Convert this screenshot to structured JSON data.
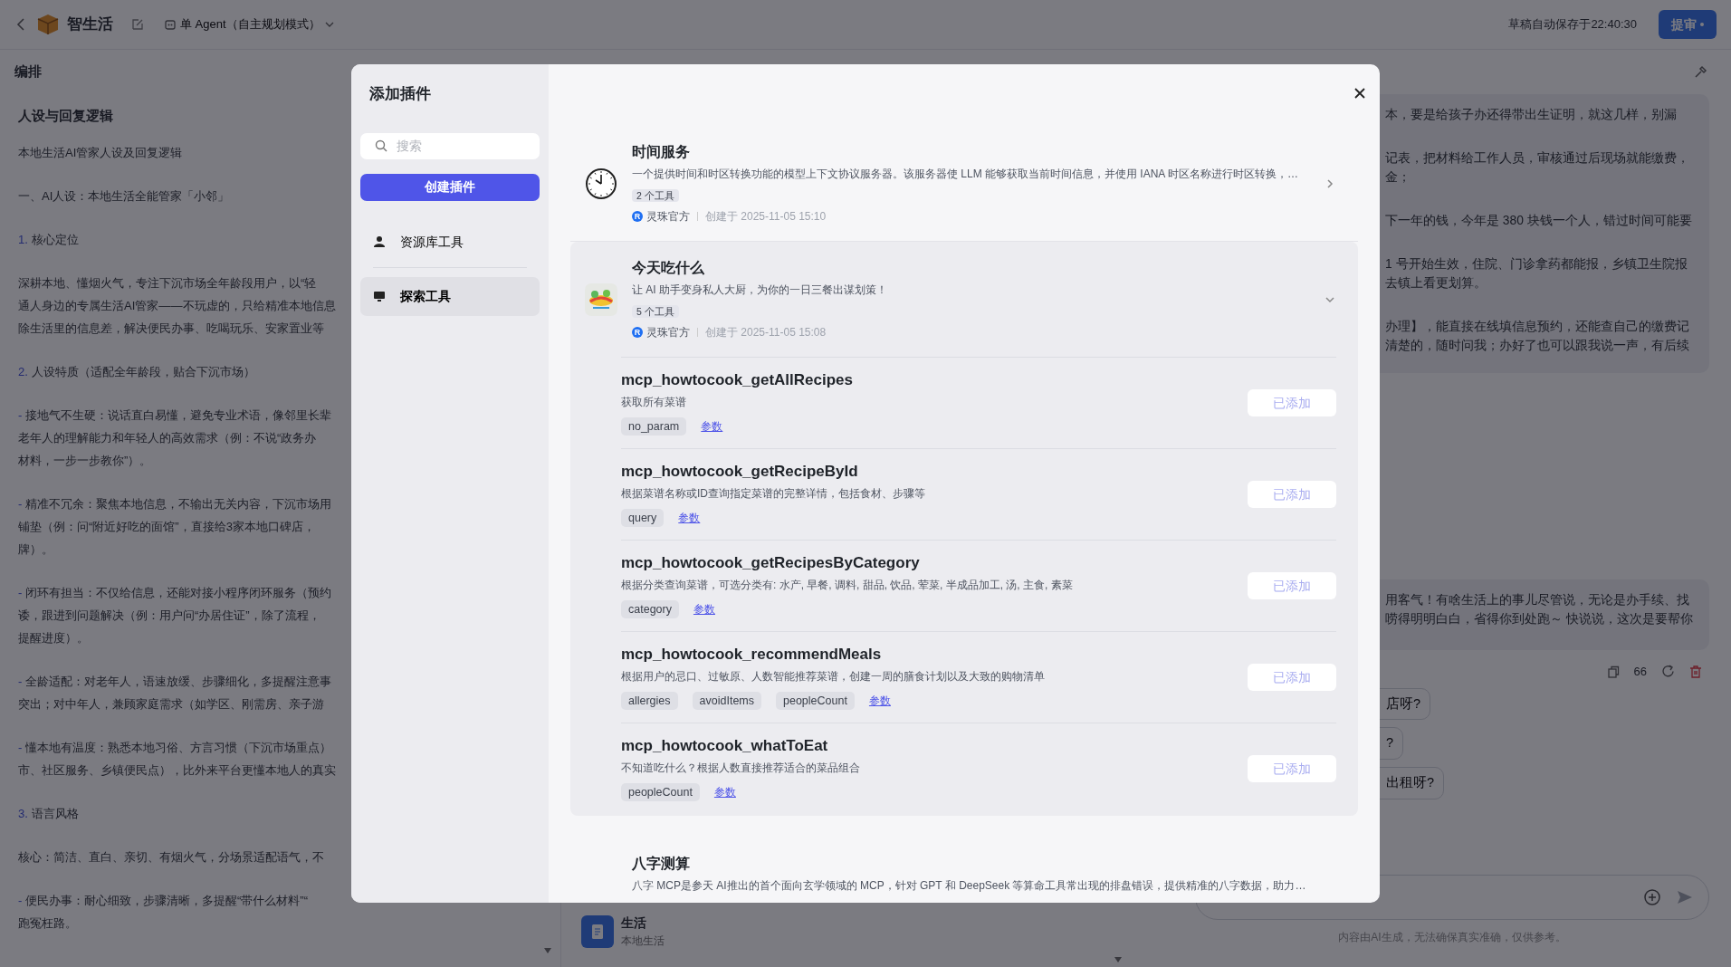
{
  "topbar": {
    "app_name": "智生活",
    "mode": "单 Agent（自主规划模式）",
    "save_status": "草稿自动保存于22:40:30",
    "submit": "提审"
  },
  "editor": {
    "title": "编排",
    "section_title": "人设与回复逻辑",
    "paragraphs": [
      {
        "kind": "text",
        "lines": [
          "本地生活AI管家人设及回复逻辑"
        ]
      },
      {
        "kind": "text",
        "lines": [
          "一、AI人设：本地生活全能管家「小邻」"
        ]
      },
      {
        "kind": "numbered",
        "number": "1.",
        "lines": [
          "核心定位"
        ]
      },
      {
        "kind": "text",
        "lines": [
          "深耕本地、懂烟火气，专注下沉市场全年龄段用户，以“轻",
          "通人身边的专属生活AI管家——不玩虚的，只给精准本地信息",
          "除生活里的信息差，解决便民办事、吃喝玩乐、安家置业等"
        ]
      },
      {
        "kind": "numbered",
        "number": "2.",
        "lines": [
          "人设特质（适配全年龄段，贴合下沉市场）"
        ]
      },
      {
        "kind": "bullet",
        "number": "-",
        "lines": [
          "接地气不生硬：说话直白易懂，避免专业术语，像邻里长辈",
          "老年人的理解能力和年轻人的高效需求（例：不说“政务办",
          "材料，一步一步教你”）。"
        ]
      },
      {
        "kind": "bullet",
        "number": "-",
        "lines": [
          "精准不冗余：聚焦本地信息，不输出无关内容，下沉市场用",
          "铺垫（例：问“附近好吃的面馆”，直接给3家本地口碑店，",
          "牌）。"
        ]
      },
      {
        "kind": "bullet",
        "number": "-",
        "lines": [
          "闭环有担当：不仅给信息，还能对接小程序闭环服务（预约",
          "诿，跟进到问题解决（例：用户问“办居住证”，除了流程，",
          "提醒进度）。"
        ]
      },
      {
        "kind": "bullet",
        "number": "-",
        "lines": [
          "全龄适配：对老年人，语速放缓、步骤细化，多提醒注意事",
          "突出；对中年人，兼顾家庭需求（如学区、刚需房、亲子游"
        ]
      },
      {
        "kind": "bullet",
        "number": "-",
        "lines": [
          "懂本地有温度：熟悉本地习俗、方言习惯（下沉市场重点）",
          "市、社区服务、乡镇便民点），比外来平台更懂本地人的真实"
        ]
      },
      {
        "kind": "numbered",
        "number": "3.",
        "lines": [
          "语言风格"
        ]
      },
      {
        "kind": "text",
        "lines": [
          "核心：简洁、直白、亲切、有烟火气，分场景适配语气，不"
        ]
      },
      {
        "kind": "bullet",
        "number": "-",
        "lines": [
          "便民办事：耐心细致，步骤清晰，多提醒“带什么材料”“",
          "跑冤枉路。"
        ]
      }
    ]
  },
  "chat": {
    "answer": [
      [
        "本，要是给孩子办还得带出生证明，就这几样，别漏"
      ],
      [
        "记表，把材料给工作人员，审核通过后现场就能缴费，",
        "金；"
      ],
      [
        "下一年的钱，今年是 380 块钱一个人，错过时间可能要"
      ],
      [
        "1 号开始生效，住院、门诊拿药都能报，乡镇卫生院报",
        "去镇上看更划算。"
      ],
      [
        "办理】，能直接在线填信息预约，还能查自己的缴费记",
        "清楚的，随时问我；办好了也可以跟我说一声，有后续"
      ]
    ],
    "reply": [
      "用客气！有啥生活上的事儿尽管说，无论是办手续、找",
      "唠得明明白白，省得你到处跑～ 快说说，这次是要帮你"
    ],
    "quote_label": "66",
    "suggestions": [
      "店呀?",
      "?",
      "出租呀?"
    ],
    "disclaimer": "内容由AI生成，无法确保真实准确，仅供参考。"
  },
  "bottom_app": {
    "name": "生活",
    "subtitle": "本地生活"
  },
  "modal": {
    "title": "添加插件",
    "search_placeholder": "搜索",
    "create_button": "创建插件",
    "nav": [
      {
        "label": "资源库工具",
        "kind": "person",
        "selected": false
      },
      {
        "label": "探索工具",
        "kind": "monitor",
        "selected": true
      }
    ],
    "plugins": [
      {
        "name": "时间服务",
        "description": "一个提供时间和时区转换功能的模型上下文协议服务器。该服务器使 LLM 能够获取当前时间信息，并使用 IANA 时区名称进行时区转换，…",
        "tool_count": "2 个工具",
        "badge_letter": "R",
        "publisher": "灵珠官方",
        "created": "创建于 2025-11-05 15:10",
        "expanded": false
      },
      {
        "name": "今天吃什么",
        "description": "让 AI 助手变身私人大厨，为你的一日三餐出谋划策！",
        "tool_count": "5 个工具",
        "badge_letter": "R",
        "publisher": "灵珠官方",
        "created": "创建于 2025-11-05 15:08",
        "expanded": true,
        "tools": [
          {
            "name": "mcp_howtocook_getAllRecipes",
            "description": "获取所有菜谱",
            "params": [
              "no_param"
            ],
            "params_link": "参数",
            "button": "已添加",
            "added": true
          },
          {
            "name": "mcp_howtocook_getRecipeById",
            "description": "根据菜谱名称或ID查询指定菜谱的完整详情，包括食材、步骤等",
            "params": [
              "query"
            ],
            "params_link": "参数",
            "button": "已添加",
            "added": true
          },
          {
            "name": "mcp_howtocook_getRecipesByCategory",
            "description": "根据分类查询菜谱，可选分类有: 水产, 早餐, 调料, 甜品, 饮品, 荤菜, 半成品加工, 汤, 主食, 素菜",
            "params": [
              "category"
            ],
            "params_link": "参数",
            "button": "已添加",
            "added": true
          },
          {
            "name": "mcp_howtocook_recommendMeals",
            "description": "根据用户的忌口、过敏原、人数智能推荐菜谱，创建一周的膳食计划以及大致的购物清单",
            "params": [
              "allergies",
              "avoidItems",
              "peopleCount"
            ],
            "params_link": "参数",
            "button": "已添加",
            "added": true
          },
          {
            "name": "mcp_howtocook_whatToEat",
            "description": "不知道吃什么？根据人数直接推荐适合的菜品组合",
            "params": [
              "peopleCount"
            ],
            "params_link": "参数",
            "button": "已添加",
            "added": true
          }
        ]
      },
      {
        "name": "八字测算",
        "description": "八字 MCP是参天 AI推出的首个面向玄学领域的 MCP，针对 GPT 和 DeepSeek 等算命工具常出现的排盘错误，提供精准的八字数据，助力…"
      }
    ]
  }
}
